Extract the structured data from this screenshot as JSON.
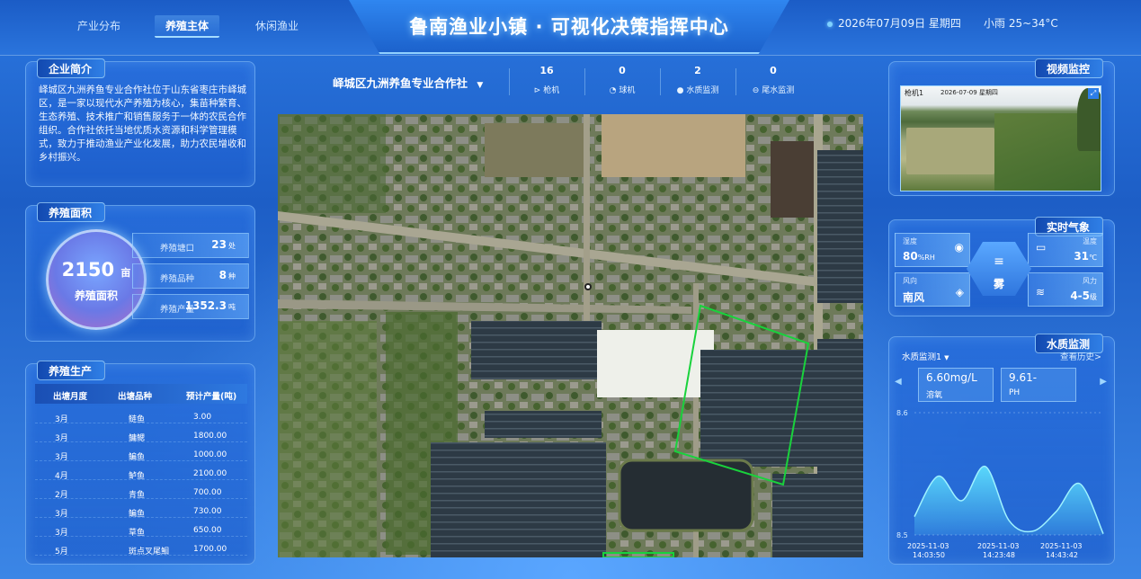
{
  "header": {
    "title": "鲁南渔业小镇 · 可视化决策指挥中心",
    "tabs": [
      {
        "label": "产业分布",
        "active": false
      },
      {
        "label": "养殖主体",
        "active": true
      },
      {
        "label": "休闲渔业",
        "active": false
      }
    ],
    "date": "2026年07月09日 星期四",
    "weather": "小雨 25~34°C"
  },
  "company_intro": {
    "title": "企业简介",
    "text": "峄城区九洲养鱼专业合作社位于山东省枣庄市峄城区，是一家以现代水产养殖为核心，集苗种繁育、生态养殖、技术推广和销售服务于一体的农民合作组织。合作社依托当地优质水资源和科学管理模式，致力于推动渔业产业化发展，助力农民增收和乡村振兴。"
  },
  "area": {
    "title": "养殖面积",
    "value": "2150",
    "unit": "亩",
    "label": "养殖面积",
    "stats": [
      {
        "label": "养殖塘口",
        "value": "23",
        "unit": "处"
      },
      {
        "label": "养殖品种",
        "value": "8",
        "unit": "种"
      },
      {
        "label": "养殖产量",
        "value": "1352.3",
        "unit": "吨"
      }
    ]
  },
  "production": {
    "title": "养殖生产",
    "headers": [
      "出塘月度",
      "出塘品种",
      "预计产量(吨)"
    ],
    "rows": [
      [
        "3月",
        "鲢鱼",
        "3.00"
      ],
      [
        "3月",
        "鳙鳃",
        "1800.00"
      ],
      [
        "3月",
        "鳊鱼",
        "1000.00"
      ],
      [
        "4月",
        "鲈鱼",
        "2100.00"
      ],
      [
        "2月",
        "青鱼",
        "700.00"
      ],
      [
        "3月",
        "鳊鱼",
        "730.00"
      ],
      [
        "3月",
        "草鱼",
        "650.00"
      ],
      [
        "5月",
        "斑点叉尾鮰",
        "1700.00"
      ]
    ]
  },
  "center": {
    "cooperative": "峄城区九洲养鱼专业合作社",
    "dropdown_icon": "caret-down",
    "stats": [
      {
        "value": "16",
        "label": "枪机",
        "icon": "camera-icon"
      },
      {
        "value": "0",
        "label": "球机",
        "icon": "dome-camera-icon"
      },
      {
        "value": "2",
        "label": "水质监测",
        "icon": "water-drop-icon"
      },
      {
        "value": "0",
        "label": "尾水监测",
        "icon": "wastewater-icon"
      }
    ]
  },
  "video": {
    "title": "视频监控",
    "camera_label": "枪机1",
    "timestamp": "2026-07-09 星期四"
  },
  "weather_panel": {
    "title": "实时气象",
    "humidity": {
      "label": "湿度",
      "value": "80",
      "unit": "%RH"
    },
    "temperature": {
      "label": "温度",
      "value": "31",
      "unit": "℃"
    },
    "wind_dir": {
      "label": "风向",
      "value": "南风"
    },
    "wind_force": {
      "label": "风力",
      "value": "4-5",
      "unit": "级"
    },
    "condition": "雾"
  },
  "water_quality": {
    "title": "水质监测",
    "device": "水质监测1",
    "history_link": "查看历史>",
    "cards": [
      {
        "value": "6.60mg/L",
        "label": "溶氧"
      },
      {
        "value": "9.61-",
        "label": "PH"
      }
    ],
    "chart_data": {
      "type": "area",
      "ylim_labels": [
        "8.6",
        "8.5"
      ],
      "x": [
        "2025-11-03 14:03:50",
        "2025-11-03 14:23:48",
        "2025-11-03 14:43:42"
      ],
      "x_top": [
        "2025-11-03",
        "2025-11-03",
        "2025-11-03"
      ],
      "x_bottom": [
        "14:03:50",
        "14:23:48",
        "14:43:42"
      ],
      "values": [
        8.515,
        8.548,
        8.528,
        8.556,
        8.512,
        8.503,
        8.519,
        8.542,
        8.501
      ]
    }
  },
  "colors": {
    "accent": "#8fd0ff",
    "panel": "#286edc",
    "map_polygon": "#19d23c"
  }
}
